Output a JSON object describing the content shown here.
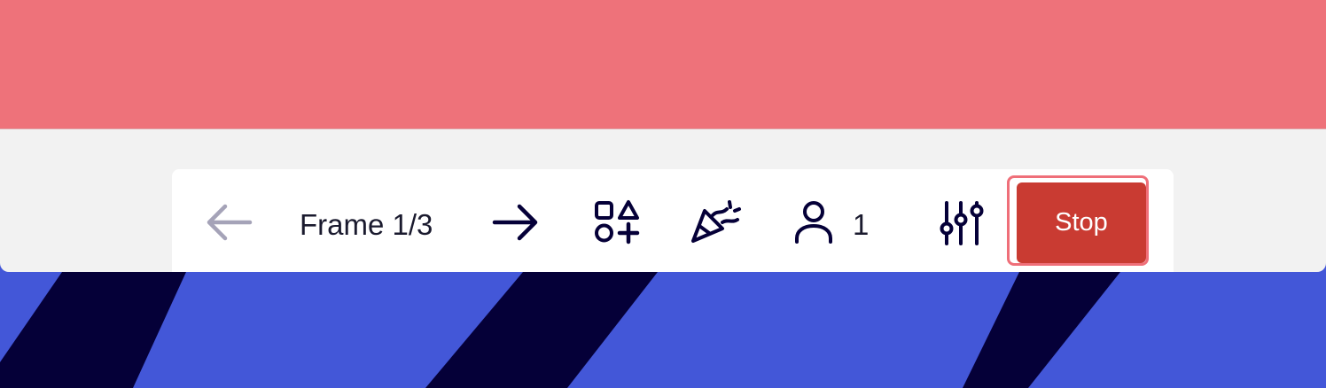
{
  "colors": {
    "banner": "#ee727a",
    "panel": "#f2f2f2",
    "toolbar_bg": "#ffffff",
    "canvas_blue": "#4357d8",
    "canvas_dark": "#050038",
    "stop_button": "#c93b32",
    "focus_ring": "#ef6f79",
    "icon_dark": "#050038",
    "icon_disabled": "#a5a3b8"
  },
  "toolbar": {
    "previous": {
      "icon": "arrow-left-icon",
      "enabled": false
    },
    "frame_label": "Frame 1/3",
    "next": {
      "icon": "arrow-right-icon",
      "enabled": true
    },
    "shapes": {
      "icon": "shapes-plus-icon"
    },
    "celebrate": {
      "icon": "party-popper-icon"
    },
    "participants": {
      "icon": "user-icon",
      "count": "1"
    },
    "settings": {
      "icon": "sliders-icon"
    },
    "stop_label": "Stop"
  }
}
